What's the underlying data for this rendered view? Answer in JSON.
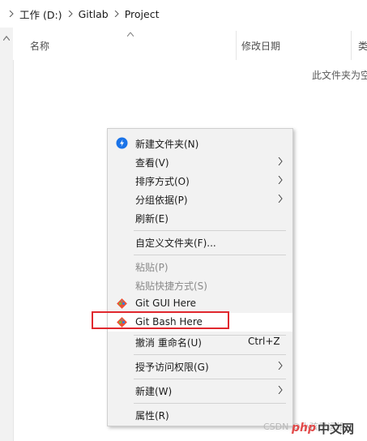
{
  "breadcrumb": {
    "items": [
      "工作 (D:)",
      "Gitlab",
      "Project"
    ]
  },
  "columns": {
    "name": "名称",
    "modified": "修改日期",
    "type": "类"
  },
  "empty_message": "此文件夹为空",
  "context_menu": {
    "items": [
      {
        "label": "新建文件夹(N)"
      },
      {
        "label": "查看(V)"
      },
      {
        "label": "排序方式(O)"
      },
      {
        "label": "分组依据(P)"
      },
      {
        "label": "刷新(E)"
      },
      {
        "label": "自定义文件夹(F)..."
      },
      {
        "label": "粘贴(P)"
      },
      {
        "label": "粘贴快捷方式(S)"
      },
      {
        "label": "Git GUI Here"
      },
      {
        "label": "Git Bash Here"
      },
      {
        "label": "撤消 重命名(U)",
        "shortcut": "Ctrl+Z"
      },
      {
        "label": "授予访问权限(G)"
      },
      {
        "label": "新建(W)"
      },
      {
        "label": "属性(R)"
      }
    ]
  },
  "watermark": "CSDN @小孩子运维",
  "logo": {
    "badge": "php",
    "text": "中文网"
  },
  "colors": {
    "highlight_box": "#e0282e",
    "menu_background": "#f2f2f2",
    "new_folder_icon": "#1a73e8",
    "git_icon": "#f05033"
  }
}
